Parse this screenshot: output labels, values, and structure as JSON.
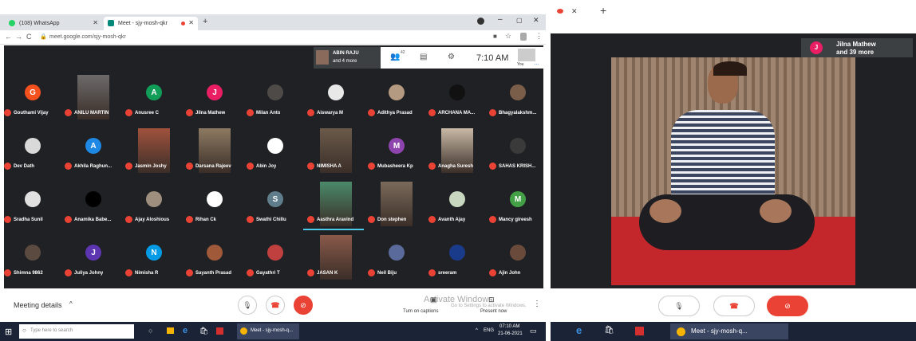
{
  "left": {
    "tabs": [
      {
        "title": "(108) WhatsApp",
        "color": "#25d366"
      },
      {
        "title": "Meet - sjy-mosh-qkr",
        "color": "#00897b"
      }
    ],
    "address": "meet.google.com/sjy-mosh-qkr",
    "header": {
      "presenter_name": "ABIN RAJU",
      "presenter_more": "and 4 more",
      "participant_count": "42",
      "time": "7:10 AM",
      "self_label": "You"
    },
    "participants": [
      {
        "name": "Gouthami Vijay",
        "initial": "G",
        "color": "#f4511e",
        "type": "avatar"
      },
      {
        "name": "ANILU MARTIN",
        "initial": "",
        "color": "#6d6a6a",
        "type": "photo"
      },
      {
        "name": "Anusree C",
        "initial": "A",
        "color": "#0f9d58",
        "type": "avatar"
      },
      {
        "name": "Jilna Mathew",
        "initial": "J",
        "color": "#e91e63",
        "type": "avatar"
      },
      {
        "name": "Milan Anto",
        "initial": "",
        "color": "#4e4a48",
        "type": "pic"
      },
      {
        "name": "Aiswarya M",
        "initial": "",
        "color": "#e8e8e8",
        "type": "pic"
      },
      {
        "name": "Adithya Prasad",
        "initial": "",
        "color": "#b49a80",
        "type": "pic"
      },
      {
        "name": "ARCHANA MA...",
        "initial": "",
        "color": "#111111",
        "type": "pic"
      },
      {
        "name": "Bhagyalakshm...",
        "initial": "",
        "color": "#7a5e4a",
        "type": "pic"
      },
      {
        "name": "Dev Dath",
        "initial": "",
        "color": "#d9d9d9",
        "type": "pic"
      },
      {
        "name": "Akhila Raghun...",
        "initial": "A",
        "color": "#1e88e5",
        "type": "avatar"
      },
      {
        "name": "Jasmin Joshy",
        "initial": "",
        "color": "#a0523d",
        "type": "photo"
      },
      {
        "name": "Darsana Rajeev",
        "initial": "",
        "color": "#8d7a62",
        "type": "photo"
      },
      {
        "name": "Abin Joy",
        "initial": "",
        "color": "#ffffff",
        "type": "pic"
      },
      {
        "name": "NIMISHA A",
        "initial": "",
        "color": "#6b5a4a",
        "type": "photo"
      },
      {
        "name": "Mubasheera Kp",
        "initial": "M",
        "color": "#8e44ad",
        "type": "avatar"
      },
      {
        "name": "Anagha Suresh",
        "initial": "",
        "color": "#c9b9a6",
        "type": "photo"
      },
      {
        "name": "SAHAS KRISH...",
        "initial": "",
        "color": "#3a3a3a",
        "type": "pic"
      },
      {
        "name": "Sradha Sunil",
        "initial": "",
        "color": "#e0e0e0",
        "type": "pic"
      },
      {
        "name": "Anamika Babe...",
        "initial": "",
        "color": "#000000",
        "type": "pic"
      },
      {
        "name": "Ajay Aloshious",
        "initial": "",
        "color": "#9e8e7e",
        "type": "pic"
      },
      {
        "name": "Rihan Ck",
        "initial": "",
        "color": "#ffffff",
        "type": "pic"
      },
      {
        "name": "Swathi Chillu",
        "initial": "S",
        "color": "#607d8b",
        "type": "avatar"
      },
      {
        "name": "Aasthra Aravind",
        "initial": "",
        "color": "#4a8a6a",
        "type": "photo"
      },
      {
        "name": "Don stephen",
        "initial": "",
        "color": "#7a6a5a",
        "type": "photo"
      },
      {
        "name": "Avanth Ajay",
        "initial": "",
        "color": "#c8d8c0",
        "type": "pic"
      },
      {
        "name": "Mancy gireesh",
        "initial": "M",
        "color": "#43a047",
        "type": "avatar"
      },
      {
        "name": "Shimna 9862",
        "initial": "",
        "color": "#5a4a40",
        "type": "pic"
      },
      {
        "name": "Juliya Johny",
        "initial": "J",
        "color": "#5e35b1",
        "type": "avatar"
      },
      {
        "name": "Nimisha R",
        "initial": "N",
        "color": "#039be5",
        "type": "avatar"
      },
      {
        "name": "Sayanth Prasad",
        "initial": "",
        "color": "#a05a3a",
        "type": "pic"
      },
      {
        "name": "Gayathri T",
        "initial": "",
        "color": "#c04040",
        "type": "pic"
      },
      {
        "name": "JASAN K",
        "initial": "",
        "color": "#8a5a4a",
        "type": "photo"
      },
      {
        "name": "Neil Biju",
        "initial": "",
        "color": "#5a6a9a",
        "type": "pic"
      },
      {
        "name": "sreeram",
        "initial": "",
        "color": "#1a3a8a",
        "type": "pic"
      },
      {
        "name": "Ajin John",
        "initial": "",
        "color": "#6a4a3a",
        "type": "pic"
      }
    ],
    "bottom": {
      "meeting_details": "Meeting details",
      "captions": "Turn on captions",
      "present": "Present now",
      "activate_title": "Activate Windows",
      "activate_sub": "Go to Settings to activate Windows."
    },
    "taskbar": {
      "search_placeholder": "Type here to search",
      "meet_task": "Meet - sjy-mosh-q...",
      "time": "07:10 AM",
      "date": "21-06-2021",
      "lang": "ENG"
    }
  },
  "right": {
    "speaker_name": "Jilna Mathew",
    "speaker_more": "and 39 more",
    "speaker_initial": "J",
    "taskbar_meet": "Meet - sjy-mosh-q..."
  }
}
